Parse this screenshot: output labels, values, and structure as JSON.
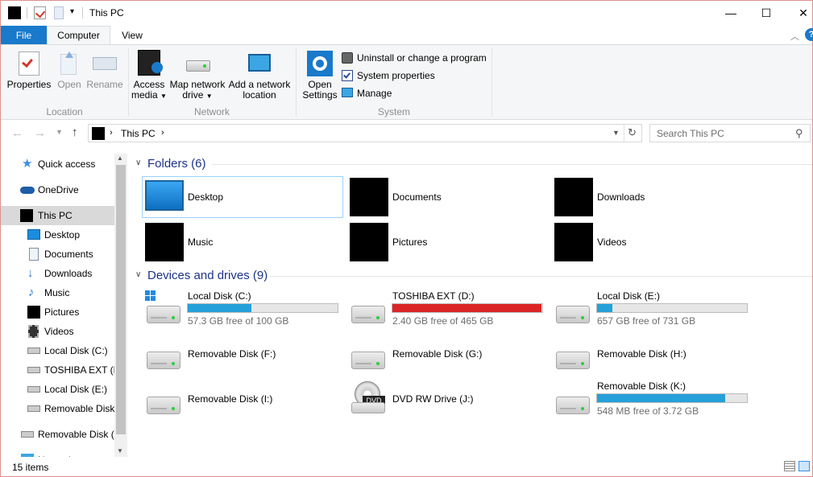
{
  "window": {
    "title": "This PC"
  },
  "ribbon_tabs": {
    "file": "File",
    "computer": "Computer",
    "view": "View"
  },
  "ribbon": {
    "location": {
      "label": "Location",
      "properties": "Properties",
      "open": "Open",
      "rename": "Rename"
    },
    "network": {
      "label": "Network",
      "access_media_1": "Access",
      "access_media_2": "media",
      "map_drive_1": "Map network",
      "map_drive_2": "drive",
      "add_location_1": "Add a network",
      "add_location_2": "location"
    },
    "system": {
      "label": "System",
      "open_settings_1": "Open",
      "open_settings_2": "Settings",
      "uninstall": "Uninstall or change a program",
      "system_properties": "System properties",
      "manage": "Manage"
    }
  },
  "address": {
    "crumb": "This PC",
    "search_placeholder": "Search This PC"
  },
  "sidebar": {
    "items": [
      {
        "label": "Quick access"
      },
      {
        "label": "OneDrive"
      },
      {
        "label": "This PC"
      },
      {
        "label": "Desktop"
      },
      {
        "label": "Documents"
      },
      {
        "label": "Downloads"
      },
      {
        "label": "Music"
      },
      {
        "label": "Pictures"
      },
      {
        "label": "Videos"
      },
      {
        "label": "Local Disk (C:)"
      },
      {
        "label": "TOSHIBA EXT (D"
      },
      {
        "label": "Local Disk (E:)"
      },
      {
        "label": "Removable Disk"
      },
      {
        "label": "Removable Disk (I"
      },
      {
        "label": "Network"
      }
    ]
  },
  "folders": {
    "title": "Folders (6)",
    "items": [
      {
        "label": "Desktop"
      },
      {
        "label": "Documents"
      },
      {
        "label": "Downloads"
      },
      {
        "label": "Music"
      },
      {
        "label": "Pictures"
      },
      {
        "label": "Videos"
      }
    ]
  },
  "drives": {
    "title": "Devices and drives (9)",
    "items": [
      {
        "label": "Local Disk (C:)",
        "free": "57.3 GB free of 100 GB",
        "used_fraction": 0.427
      },
      {
        "label": "TOSHIBA EXT (D:)",
        "free": "2.40 GB free of 465 GB",
        "used_fraction": 0.995
      },
      {
        "label": "Local Disk (E:)",
        "free": "657 GB free of 731 GB",
        "used_fraction": 0.101
      },
      {
        "label": "Removable Disk (F:)"
      },
      {
        "label": "Removable Disk (G:)"
      },
      {
        "label": "Removable Disk (H:)"
      },
      {
        "label": "Removable Disk (I:)"
      },
      {
        "label": "DVD RW Drive (J:)",
        "badge": "DVD"
      },
      {
        "label": "Removable Disk (K:)",
        "free": "548 MB free of 3.72 GB",
        "used_fraction": 0.856
      }
    ]
  },
  "status": {
    "items_count": "15 items"
  },
  "colors": {
    "accent": "#1979ca",
    "bar_normal": "#26a0da",
    "bar_full": "#da2626",
    "section_title": "#1e3287"
  }
}
